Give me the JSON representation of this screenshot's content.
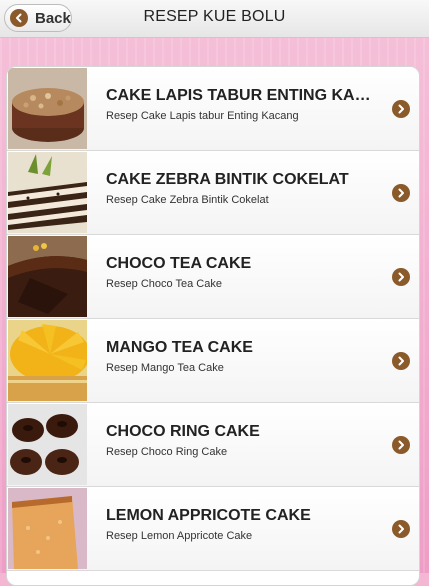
{
  "header": {
    "back_label": "Back",
    "title": "RESEP KUE BOLU",
    "back_icon": "arrow-left-icon"
  },
  "list": {
    "items": [
      {
        "title": "CAKE LAPIS TABUR ENTING KACANG",
        "subtitle": "Resep Cake Lapis tabur Enting Kacang",
        "thumb": "cake-lapis-thumbnail"
      },
      {
        "title": "CAKE ZEBRA BINTIK COKELAT",
        "subtitle": "Resep Cake Zebra Bintik Cokelat",
        "thumb": "cake-zebra-thumbnail"
      },
      {
        "title": "CHOCO TEA CAKE",
        "subtitle": "Resep Choco Tea Cake",
        "thumb": "choco-tea-cake-thumbnail"
      },
      {
        "title": "MANGO TEA CAKE",
        "subtitle": "Resep Mango Tea Cake",
        "thumb": "mango-tea-cake-thumbnail"
      },
      {
        "title": "CHOCO RING CAKE",
        "subtitle": "Resep Choco Ring Cake",
        "thumb": "choco-ring-cake-thumbnail"
      },
      {
        "title": "LEMON APPRICOTE CAKE",
        "subtitle": "Resep Lemon Appricote Cake",
        "thumb": "lemon-appricote-cake-thumbnail"
      }
    ],
    "chevron_icon": "chevron-right-icon"
  },
  "colors": {
    "accent": "#8a5a2b",
    "background": "#f3b6d3",
    "header": "#efefef"
  }
}
